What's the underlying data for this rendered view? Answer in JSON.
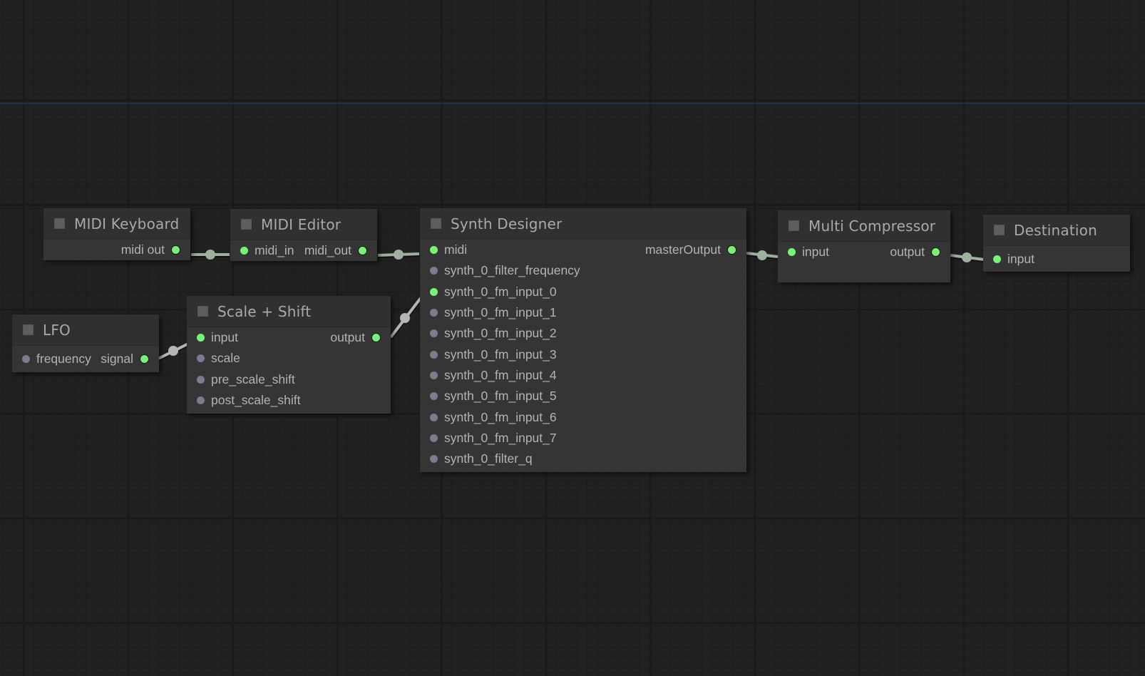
{
  "colors": {
    "background": "#212121",
    "node_body": "#353535",
    "node_header": "#303030",
    "slot_connected": "#74f574",
    "slot_unconnected": "#7d7b8e",
    "link": "#9fb09f",
    "link_alt": "#b5b5b5",
    "guide_line": "#22304a"
  },
  "nodes": {
    "midi_keyboard": {
      "title": "MIDI Keyboard",
      "inputs": [],
      "outputs": [
        {
          "label": "midi out",
          "connected": true
        }
      ]
    },
    "midi_editor": {
      "title": "MIDI Editor",
      "inputs": [
        {
          "label": "midi_in",
          "connected": true
        }
      ],
      "outputs": [
        {
          "label": "midi_out",
          "connected": true
        }
      ]
    },
    "synth_designer": {
      "title": "Synth Designer",
      "inputs": [
        {
          "label": "midi",
          "connected": true
        },
        {
          "label": "synth_0_filter_frequency",
          "connected": false
        },
        {
          "label": "synth_0_fm_input_0",
          "connected": true
        },
        {
          "label": "synth_0_fm_input_1",
          "connected": false
        },
        {
          "label": "synth_0_fm_input_2",
          "connected": false
        },
        {
          "label": "synth_0_fm_input_3",
          "connected": false
        },
        {
          "label": "synth_0_fm_input_4",
          "connected": false
        },
        {
          "label": "synth_0_fm_input_5",
          "connected": false
        },
        {
          "label": "synth_0_fm_input_6",
          "connected": false
        },
        {
          "label": "synth_0_fm_input_7",
          "connected": false
        },
        {
          "label": "synth_0_filter_q",
          "connected": false
        }
      ],
      "outputs": [
        {
          "label": "masterOutput",
          "connected": true
        }
      ]
    },
    "multi_compressor": {
      "title": "Multi Compressor",
      "inputs": [
        {
          "label": "input",
          "connected": true
        }
      ],
      "outputs": [
        {
          "label": "output",
          "connected": true
        }
      ]
    },
    "destination": {
      "title": "Destination",
      "inputs": [
        {
          "label": "input",
          "connected": true
        }
      ],
      "outputs": []
    },
    "lfo": {
      "title": "LFO",
      "inputs": [
        {
          "label": "frequency",
          "connected": false
        }
      ],
      "outputs": [
        {
          "label": "signal",
          "connected": true
        }
      ]
    },
    "scale_shift": {
      "title": "Scale + Shift",
      "inputs": [
        {
          "label": "input",
          "connected": true
        },
        {
          "label": "scale",
          "connected": false
        },
        {
          "label": "pre_scale_shift",
          "connected": false
        },
        {
          "label": "post_scale_shift",
          "connected": false
        }
      ],
      "outputs": [
        {
          "label": "output",
          "connected": true
        }
      ]
    }
  },
  "links": [
    {
      "from": "midi_keyboard.midi out",
      "to": "midi_editor.midi_in"
    },
    {
      "from": "midi_editor.midi_out",
      "to": "synth_designer.midi"
    },
    {
      "from": "synth_designer.masterOutput",
      "to": "multi_compressor.input"
    },
    {
      "from": "multi_compressor.output",
      "to": "destination.input"
    },
    {
      "from": "lfo.signal",
      "to": "scale_shift.input"
    },
    {
      "from": "scale_shift.output",
      "to": "synth_designer.synth_0_fm_input_0"
    }
  ]
}
